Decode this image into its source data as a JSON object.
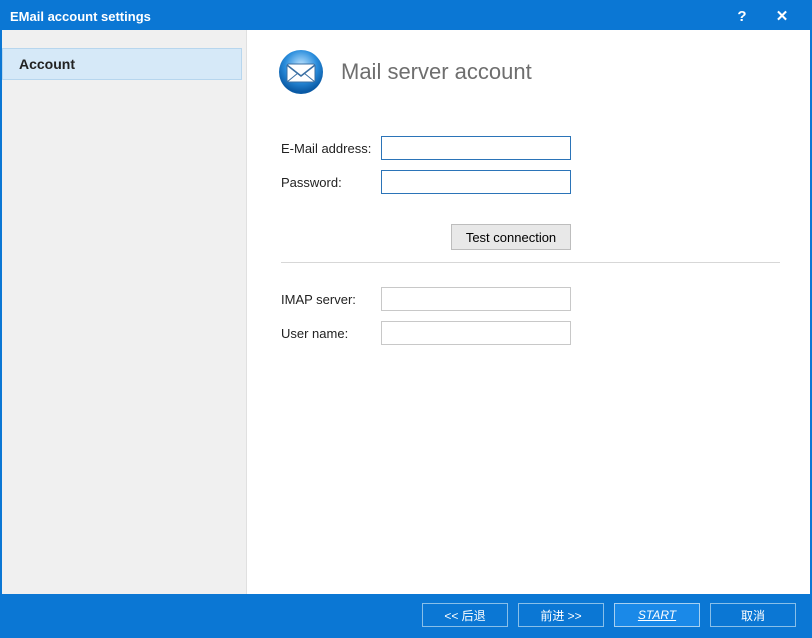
{
  "titlebar": {
    "title": "EMail account settings",
    "help": "?",
    "close": "✕"
  },
  "sidebar": {
    "items": [
      {
        "label": "Account"
      }
    ]
  },
  "main": {
    "heading": "Mail server account",
    "fields": {
      "email_label": "E-Mail address:",
      "email_value": "",
      "password_label": "Password:",
      "password_value": "",
      "imap_label": "IMAP server:",
      "imap_value": "",
      "username_label": "User name:",
      "username_value": ""
    },
    "test_button": "Test connection"
  },
  "footer": {
    "back": "<< 后退",
    "forward": "前进 >>",
    "start": "START",
    "cancel": "取消"
  }
}
